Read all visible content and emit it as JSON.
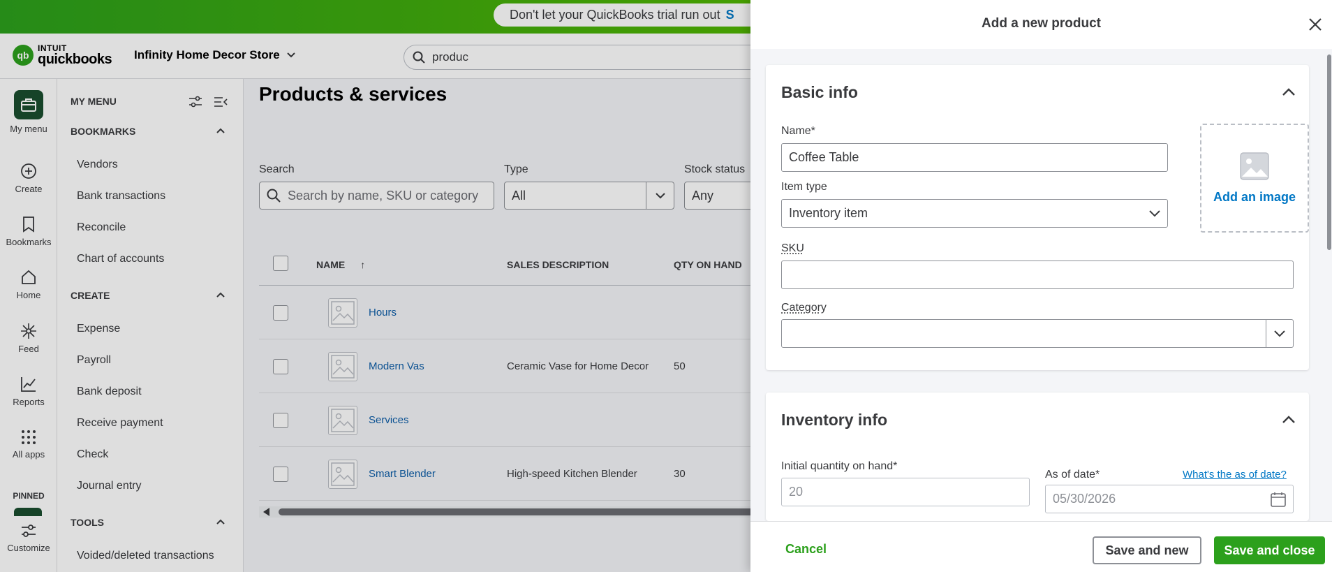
{
  "promo": {
    "text": "Don't let your QuickBooks trial run out",
    "cta": "S"
  },
  "brand": {
    "intuit": "INTUIT",
    "product": "quickbooks"
  },
  "header": {
    "company": "Infinity Home Decor Store",
    "search_value": "produc"
  },
  "rail": {
    "items": [
      "My menu",
      "Create",
      "Bookmarks",
      "Home",
      "Feed",
      "Reports",
      "All apps",
      "Customize"
    ],
    "pinned": "PINNED"
  },
  "menu": {
    "title": "MY MENU",
    "bookmarks_head": "BOOKMARKS",
    "bookmarks": [
      "Vendors",
      "Bank transactions",
      "Reconcile",
      "Chart of accounts"
    ],
    "create_head": "CREATE",
    "create": [
      "Expense",
      "Payroll",
      "Bank deposit",
      "Receive payment",
      "Check",
      "Journal entry"
    ],
    "tools_head": "TOOLS",
    "tools": [
      "Voided/deleted transactions"
    ]
  },
  "page": {
    "title": "Products & services",
    "search_label": "Search",
    "search_placeholder": "Search by name, SKU or category",
    "type_label": "Type",
    "type_value": "All",
    "stock_label": "Stock status",
    "stock_value": "Any"
  },
  "table": {
    "columns": [
      "NAME",
      "SALES DESCRIPTION",
      "QTY ON HAND"
    ],
    "rows": [
      {
        "name": "Hours",
        "description": "",
        "qty": ""
      },
      {
        "name": "Modern Vas",
        "description": "Ceramic Vase for Home Decor",
        "qty": "50"
      },
      {
        "name": "Services",
        "description": "",
        "qty": ""
      },
      {
        "name": "Smart Blender",
        "description": "High-speed Kitchen Blender",
        "qty": "30"
      }
    ]
  },
  "panel": {
    "title": "Add a new product",
    "basic": {
      "title": "Basic info",
      "name_label": "Name*",
      "name_value": "Coffee Table",
      "type_label": "Item type",
      "type_value": "Inventory item",
      "sku_label": "SKU",
      "sku_value": "",
      "category_label": "Category",
      "category_value": "",
      "image_label": "Add an image"
    },
    "inventory": {
      "title": "Inventory info",
      "qty_label": "Initial quantity on hand*",
      "qty_value": "20",
      "date_label": "As of date*",
      "date_help": "What's the as of date?",
      "date_value": "05/30/2026"
    },
    "footer": {
      "cancel": "Cancel",
      "save_new": "Save and new",
      "save_close": "Save and close"
    }
  },
  "colors": {
    "brand_green": "#2ca01c",
    "link_blue": "#0077c5",
    "dark_green": "#1a4d2e"
  }
}
